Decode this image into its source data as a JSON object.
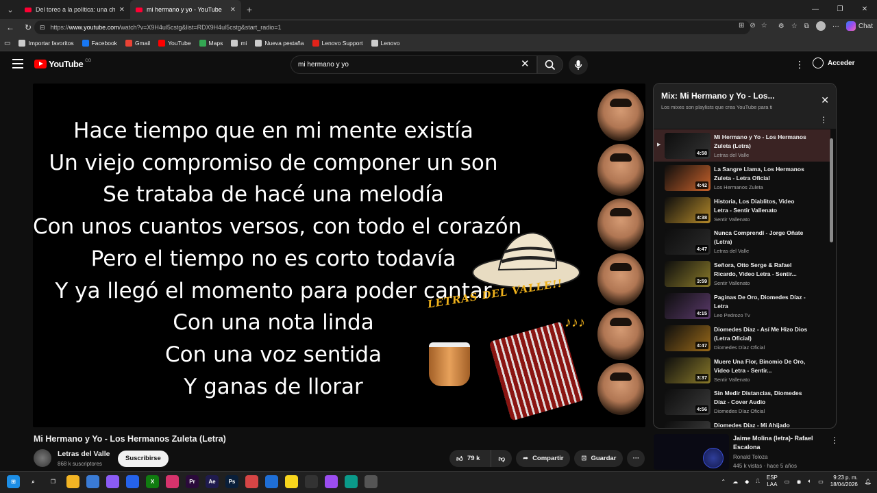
{
  "browser": {
    "tabs": [
      {
        "title": "Del toreo a la política: una charla c",
        "close": "✕"
      },
      {
        "title": "mi hermano y yo - YouTube",
        "close": "✕"
      }
    ],
    "new_tab": "+",
    "url_prefix": "https://",
    "url_host": "www.youtube.com",
    "url_rest": "/watch?v=X9H4ul5cstg&list=RDX9H4ul5cstg&start_radio=1",
    "chat_label": "Chat",
    "bookmarks": [
      {
        "label": "Importar favoritos",
        "icon": "import-icon",
        "color": "#cccccc"
      },
      {
        "label": "Facebook",
        "icon": "facebook-icon",
        "color": "#1877f2"
      },
      {
        "label": "Gmail",
        "icon": "gmail-icon",
        "color": "#ea4335"
      },
      {
        "label": "YouTube",
        "icon": "youtube-icon",
        "color": "#ff0000"
      },
      {
        "label": "Maps",
        "icon": "maps-icon",
        "color": "#34a853"
      },
      {
        "label": "mi",
        "icon": "folder-icon",
        "color": "#cccccc"
      },
      {
        "label": "Nueva pestaña",
        "icon": "newtab-icon",
        "color": "#cccccc"
      },
      {
        "label": "Lenovo Support",
        "icon": "lenovo-icon",
        "color": "#e2231a"
      },
      {
        "label": "Lenovo",
        "icon": "globe-icon",
        "color": "#cccccc"
      }
    ]
  },
  "youtube": {
    "logo_text": "YouTube",
    "region": "CO",
    "search_value": "mi hermano y yo",
    "signin_label": "Acceder"
  },
  "player": {
    "lyrics": [
      "Hace tiempo que en mi mente existía",
      "Un viejo compromiso de componer un son",
      "Se trataba de hacé una melodía",
      "Con unos cuantos versos, con todo el corazón",
      "Pero el tiempo no es corto todavía",
      "Y ya llegó el momento para poder cantar",
      "Con una nota linda",
      "Con una voz sentida",
      "Y ganas de llorar"
    ],
    "banner": "LETRAS DEL VALLE!!",
    "notes": "♪♪♪"
  },
  "video": {
    "title": "Mi Hermano y Yo - Los Hermanos Zuleta (Letra)",
    "channel": "Letras del Valle",
    "subscribers": "868 k suscriptores",
    "subscribe_label": "Suscribirse",
    "likes": "79 k",
    "share_label": "Compartir",
    "save_label": "Guardar"
  },
  "playlist": {
    "title": "Mix: Mi Hermano y Yo - Los...",
    "subtitle": "Los mixes son playlists que crea YouTube para ti",
    "items": [
      {
        "title": "Mi Hermano y Yo - Los Hermanos Zuleta (Letra)",
        "channel": "Letras del Valle",
        "duration": "4:58",
        "active": true,
        "art": "#333333"
      },
      {
        "title": "La Sangre Llama, Los Hermanos Zuleta - Letra Oficial",
        "channel": "Los Hermanos Zuleta",
        "duration": "4:42",
        "active": false,
        "art": "#c9622b"
      },
      {
        "title": "Historia, Los Diablitos, Video Letra - Sentir Vallenato",
        "channel": "Sentir Vallenato",
        "duration": "4:38",
        "active": false,
        "art": "#b58a2a"
      },
      {
        "title": "Nunca Comprendí - Jorge Oñate (Letra)",
        "channel": "Letras del Valle",
        "duration": "4:47",
        "active": false,
        "art": "#2b2b2b"
      },
      {
        "title": "Señora, Otto Serge & Rafael Ricardo, Video Letra - Sentir...",
        "channel": "Sentir Vallenato",
        "duration": "3:59",
        "active": false,
        "art": "#8a7a2a"
      },
      {
        "title": "Paginas De Oro, Diomedes Díaz - Letra",
        "channel": "Leo Pedrozo Tv",
        "duration": "4:15",
        "active": false,
        "art": "#5a3a6a"
      },
      {
        "title": "Diomedes Díaz - Así Me Hizo Dios (Letra Oficial)",
        "channel": "Diomedes Díaz Oficial",
        "duration": "4:47",
        "active": false,
        "art": "#9a6a1a"
      },
      {
        "title": "Muere Una Flor, Binomio De Oro, Video Letra - Sentir...",
        "channel": "Sentir Vallenato",
        "duration": "3:37",
        "active": false,
        "art": "#8a7a2a"
      },
      {
        "title": "Sin Medir Distancias, Diomedes Díaz - Cover Audio",
        "channel": "Diomedes Díaz Oficial",
        "duration": "4:56",
        "active": false,
        "art": "#3a3a3a"
      },
      {
        "title": "Diomedes Díaz - Mi Ahijado",
        "channel": "",
        "duration": "",
        "active": false,
        "art": "#444444"
      }
    ]
  },
  "recommendation": {
    "title": "Jaime Molina (letra)- Rafael Escalona",
    "channel": "Ronald Toloza",
    "meta": "445 k vistas · hace 5 años"
  },
  "taskbar": {
    "apps": [
      {
        "name": "windows-start-icon",
        "glyph": "⊞",
        "color": "#1c8ee6"
      },
      {
        "name": "search-icon",
        "glyph": "⌕",
        "color": "#202020"
      },
      {
        "name": "task-view-icon",
        "glyph": "❐",
        "color": "#202020"
      },
      {
        "name": "file-explorer-icon",
        "glyph": "",
        "color": "#f2b424"
      },
      {
        "name": "store-icon",
        "glyph": "",
        "color": "#3a7bd5"
      },
      {
        "name": "copilot-icon",
        "glyph": "",
        "color": "#8b5cf6"
      },
      {
        "name": "app-icon",
        "glyph": "",
        "color": "#2563eb"
      },
      {
        "name": "xbox-icon",
        "glyph": "X",
        "color": "#107c10"
      },
      {
        "name": "photos-icon",
        "glyph": "",
        "color": "#d6336c"
      },
      {
        "name": "premiere-icon",
        "glyph": "Pr",
        "color": "#2a0a3a"
      },
      {
        "name": "after-effects-icon",
        "glyph": "Ae",
        "color": "#1f1b4e"
      },
      {
        "name": "photoshop-icon",
        "glyph": "Ps",
        "color": "#0a1f3a"
      },
      {
        "name": "snipping-icon",
        "glyph": "",
        "color": "#d64545"
      },
      {
        "name": "vscode-icon",
        "glyph": "",
        "color": "#1f6fd6"
      },
      {
        "name": "notes-icon",
        "glyph": "",
        "color": "#f7d51d"
      },
      {
        "name": "github-icon",
        "glyph": "",
        "color": "#333333"
      },
      {
        "name": "app2-icon",
        "glyph": "",
        "color": "#9b4df0"
      },
      {
        "name": "edge-icon",
        "glyph": "",
        "color": "#0a9a8a"
      },
      {
        "name": "chrome-icon",
        "glyph": "",
        "color": "#555555"
      }
    ],
    "lang_1": "ESP",
    "lang_2": "LAA",
    "time": "9:23 p. m.",
    "date": "18/04/2026"
  },
  "colors": {
    "yt_red": "#ff0000",
    "banner_gold": "#f0b21c"
  }
}
